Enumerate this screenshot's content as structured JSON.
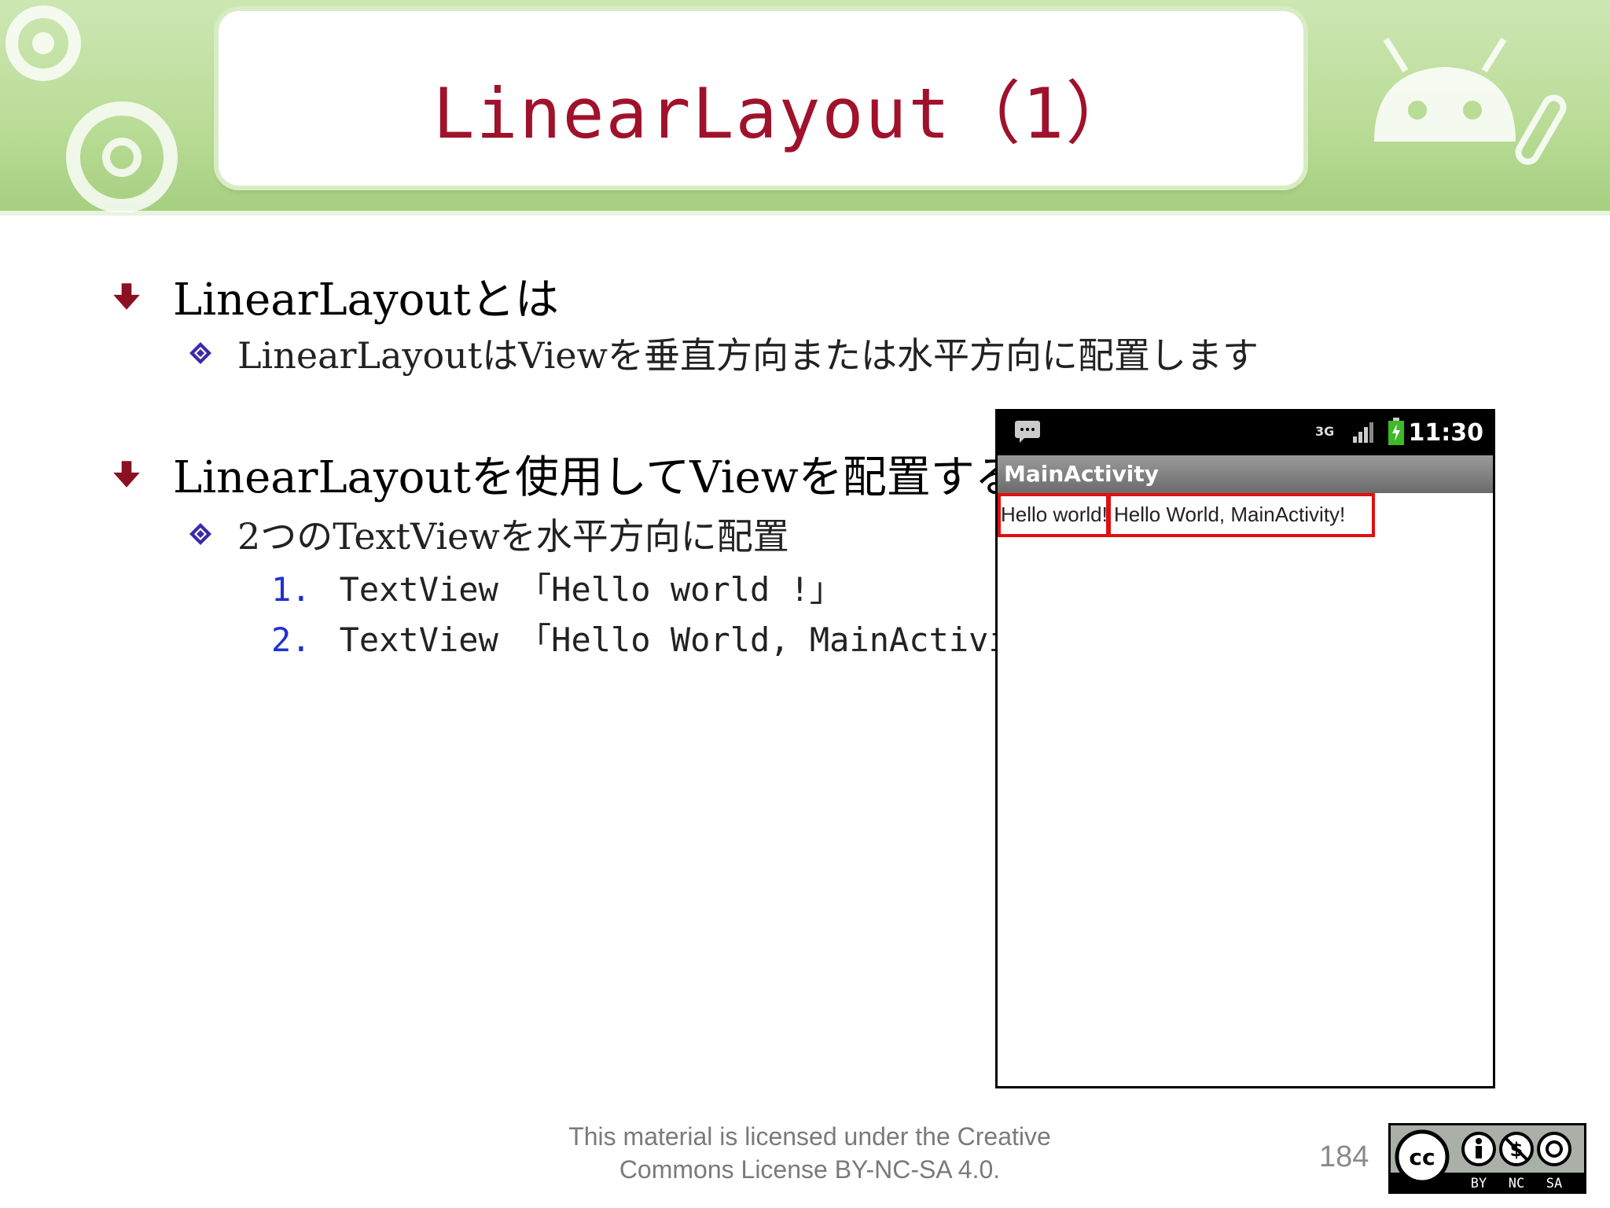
{
  "header": {
    "title": "LinearLayout（1）"
  },
  "bullets": [
    {
      "text": "LinearLayoutとは",
      "sub": "LinearLayoutはViewを垂直方向または水平方向に配置します"
    },
    {
      "text": "LinearLayoutを使用してViewを配置する",
      "sub": "2つのTextViewを水平方向に配置",
      "items": [
        {
          "num": "1.",
          "text": "TextView 「Hello world !」"
        },
        {
          "num": "2.",
          "text": "TextView 「Hello World, MainActivity!」"
        }
      ]
    }
  ],
  "phone": {
    "time": "11:30",
    "network": "3G",
    "app_title": "MainActivity",
    "textview1": "Hello world!",
    "textview2": "Hello World, MainActivity!",
    "highlight_color": "#e01010"
  },
  "footer": {
    "license_line1": "This material is licensed under the Creative",
    "license_line2": "Commons License BY-NC-SA 4.0.",
    "page_number": "184",
    "cc_labels": [
      "BY",
      "NC",
      "SA"
    ]
  },
  "colors": {
    "title": "#a0122c",
    "banner": "#b9dc96",
    "bullet_arrow": "#8b1020",
    "bullet_diamond": "#3a2aa8",
    "number": "#1f2fd6"
  }
}
